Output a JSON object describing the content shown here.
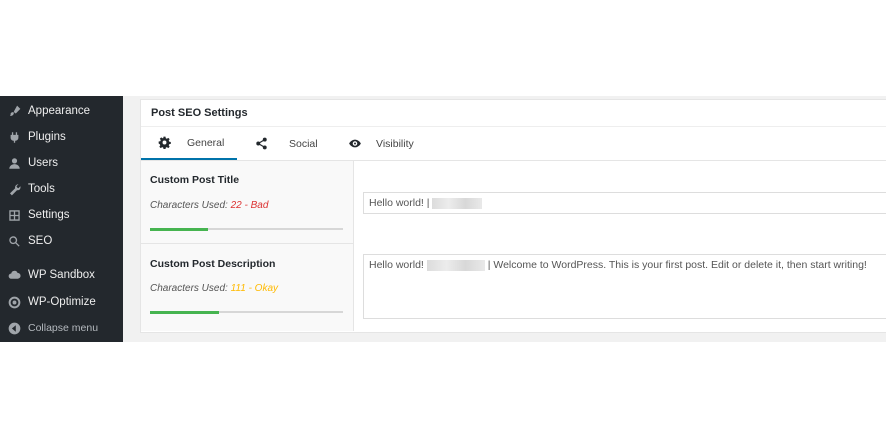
{
  "sidebar": {
    "items": [
      {
        "label": "Appearance",
        "icon": "paintbrush-icon"
      },
      {
        "label": "Plugins",
        "icon": "plug-icon"
      },
      {
        "label": "Users",
        "icon": "user-icon"
      },
      {
        "label": "Tools",
        "icon": "wrench-icon"
      },
      {
        "label": "Settings",
        "icon": "settings-grid-icon"
      },
      {
        "label": "SEO",
        "icon": "search-icon"
      },
      {
        "label": "WP Sandbox",
        "icon": "cloud-icon"
      },
      {
        "label": "WP-Optimize",
        "icon": "optimize-icon"
      }
    ],
    "collapse_label": "Collapse menu"
  },
  "panel": {
    "title": "Post SEO Settings",
    "tabs": [
      {
        "label": "General",
        "icon": "gear-icon",
        "active": true
      },
      {
        "label": "Social",
        "icon": "share-icon",
        "active": false
      },
      {
        "label": "Visibility",
        "icon": "eye-icon",
        "active": false
      }
    ]
  },
  "fields": {
    "title": {
      "label": "Custom Post Title",
      "chars_prefix": "Characters Used:",
      "chars_value": "22 - Bad",
      "progress": 0.3,
      "value_prefix": "Hello world! |"
    },
    "description": {
      "label": "Custom Post Description",
      "chars_prefix": "Characters Used:",
      "chars_value": "111 - Okay",
      "progress": 0.36,
      "value_prefix": "Hello world!",
      "value_suffix": "| Welcome to WordPress. This is your first post. Edit or delete it, then start writing!"
    }
  },
  "colors": {
    "sidebar_bg": "#23282d",
    "active_tab": "#0073aa",
    "bad": "#dc3232",
    "okay": "#ffba00",
    "progress": "#46b450"
  }
}
